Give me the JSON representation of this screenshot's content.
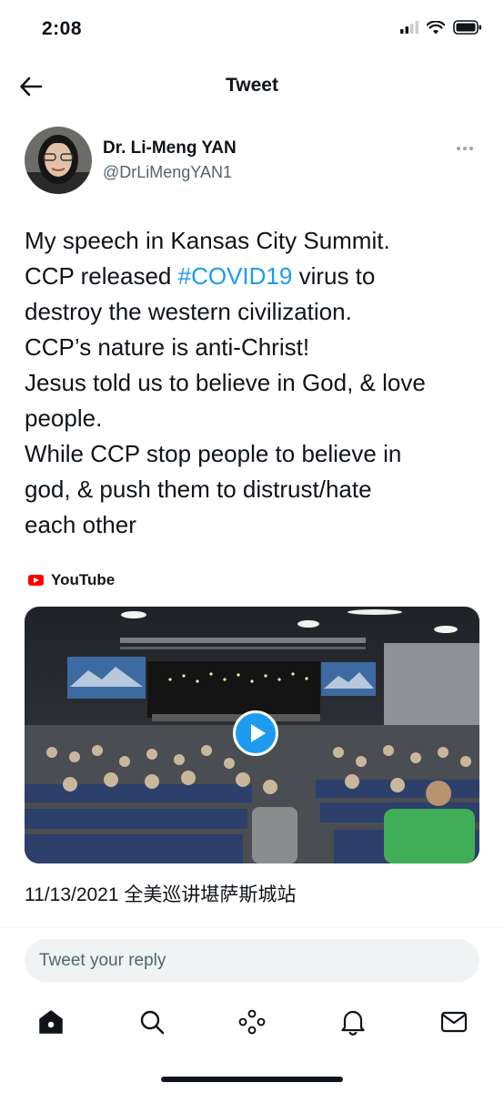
{
  "status_bar": {
    "time": "2:08",
    "icons": [
      "signal-icon",
      "wifi-icon",
      "battery-icon"
    ]
  },
  "header": {
    "title": "Tweet",
    "back_icon": "back-arrow-icon"
  },
  "tweet": {
    "author": {
      "display_name": "Dr. Li-Meng YAN",
      "handle": "@DrLiMengYAN1"
    },
    "more_icon": "more-options-icon",
    "text_lines": [
      {
        "before": "My speech in Kansas City Summit.",
        "hashtag": "",
        "after": ""
      },
      {
        "before": "CCP released ",
        "hashtag": "#COVID19",
        "after": " virus to"
      },
      {
        "before": "destroy the western civilization.",
        "hashtag": "",
        "after": ""
      },
      {
        "before": "CCP’s nature is anti-Christ!",
        "hashtag": "",
        "after": ""
      },
      {
        "before": "Jesus told us to believe in God, & love",
        "hashtag": "",
        "after": ""
      },
      {
        "before": "people.",
        "hashtag": "",
        "after": ""
      },
      {
        "before": "While CCP stop people to believe in",
        "hashtag": "",
        "after": ""
      },
      {
        "before": "god, & push them to distrust/hate",
        "hashtag": "",
        "after": ""
      },
      {
        "before": "each other",
        "hashtag": "",
        "after": ""
      }
    ],
    "media": {
      "source_label": "YouTube",
      "source_icon": "youtube-icon",
      "play_icon": "play-icon",
      "caption": "11/13/2021 全美巡讲堪萨斯城站"
    }
  },
  "reply": {
    "placeholder": "Tweet your reply"
  },
  "tab_bar": {
    "items": [
      "home-icon",
      "search-icon",
      "spaces-icon",
      "notifications-icon",
      "messages-icon"
    ]
  },
  "colors": {
    "accent": "#1d9bf0",
    "text": "#0f1419",
    "secondary_text": "#536471",
    "youtube_red": "#ff0000"
  }
}
